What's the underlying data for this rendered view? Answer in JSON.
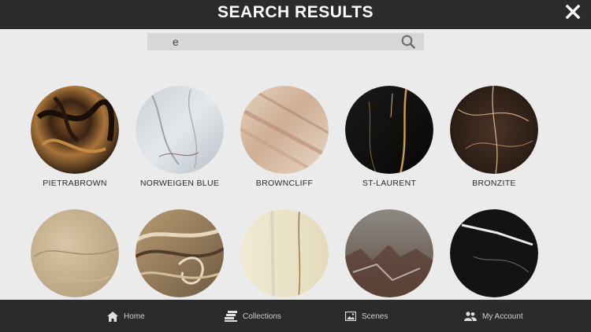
{
  "header": {
    "title": "SEARCH RESULTS"
  },
  "search": {
    "value": "e"
  },
  "results": [
    {
      "name": "PIETRABROWN"
    },
    {
      "name": "NORWEIGEN BLUE"
    },
    {
      "name": "BROWNCLIFF"
    },
    {
      "name": "ST-LAURENT"
    },
    {
      "name": "BRONZITE"
    },
    {
      "name": ""
    },
    {
      "name": ""
    },
    {
      "name": ""
    },
    {
      "name": ""
    },
    {
      "name": ""
    }
  ],
  "nav": {
    "home": "Home",
    "collections": "Collections",
    "scenes": "Scenes",
    "account": "My Account"
  },
  "colors": {
    "bar": "#2b2b2b",
    "background": "#ebebeb",
    "search_field": "#d7d7d7"
  }
}
